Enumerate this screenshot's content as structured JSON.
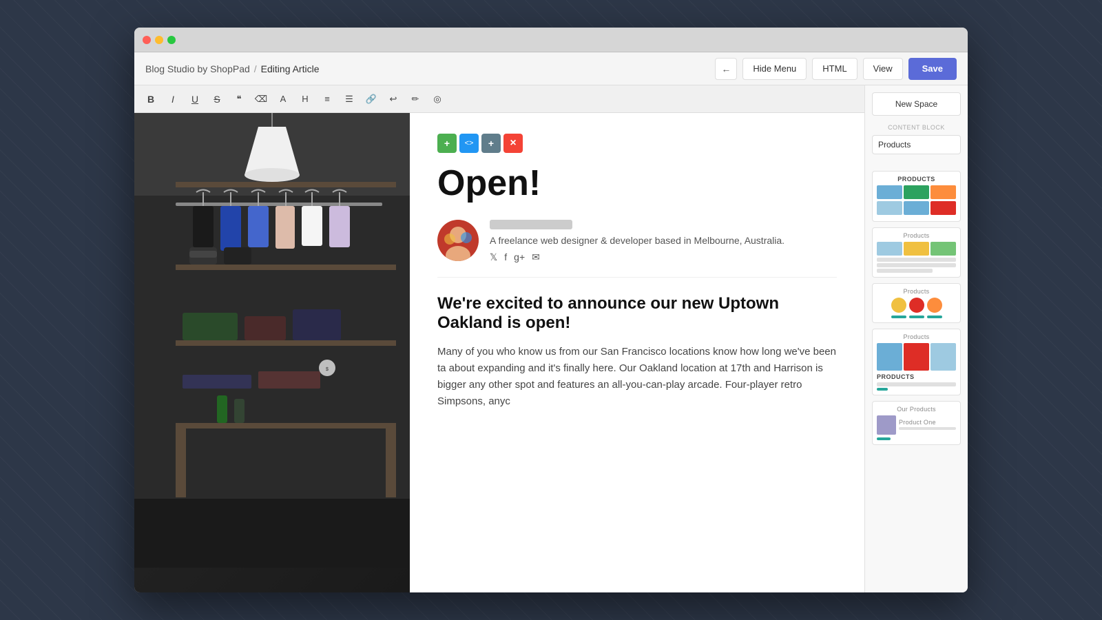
{
  "browser": {
    "traffic_lights": [
      "close",
      "minimize",
      "maximize"
    ]
  },
  "app_bar": {
    "app_name": "Blog Studio by ShopPad",
    "separator": "/",
    "current_page": "Editing Article",
    "back_button_label": "←",
    "hide_menu_label": "Hide Menu",
    "html_label": "HTML",
    "view_label": "View",
    "save_label": "Save"
  },
  "toolbar": {
    "bold": "B",
    "italic": "I",
    "underline": "U",
    "strikethrough": "S",
    "quote": "❝",
    "clear": "⌫",
    "h": "A",
    "heading": "H",
    "align_left": "≡",
    "list": "☰",
    "link": "🔗",
    "undo": "↩",
    "brush": "✏",
    "clear2": "◎"
  },
  "article": {
    "heading": "Open!",
    "author_bio": "A freelance web designer & developer based in Melbourne, Australia.",
    "social_icons": [
      "𝕏",
      "f",
      "g+",
      "✉"
    ],
    "subheading": "We're excited to announce our new Uptown Oakland is open!",
    "body": "Many of you who know us from our San Francisco locations know how long we've been ta about expanding and it's finally here. Our Oakland location at 17th and Harrison is bigger any other spot and features an all-you-can-play arcade. Four-player retro Simpsons, anyc"
  },
  "block_actions": {
    "add": "+",
    "code": "<>",
    "move": "+",
    "delete": "×"
  },
  "sidebar": {
    "new_space_label": "New Space",
    "content_block_label": "CONTENT BLOCK",
    "products_label": "Products",
    "dropdown_arrow": "⌄",
    "template_cards": [
      {
        "label": "PRODUCTS",
        "type": "grid3_large"
      },
      {
        "label": "Products",
        "type": "grid3_small"
      },
      {
        "label": "Products",
        "type": "circles"
      },
      {
        "label": "Products",
        "type": "mixed_tall"
      },
      {
        "label": "PRODUCTS",
        "type": "product_list",
        "title": "Our Products",
        "subtitle": "Product One"
      }
    ]
  }
}
